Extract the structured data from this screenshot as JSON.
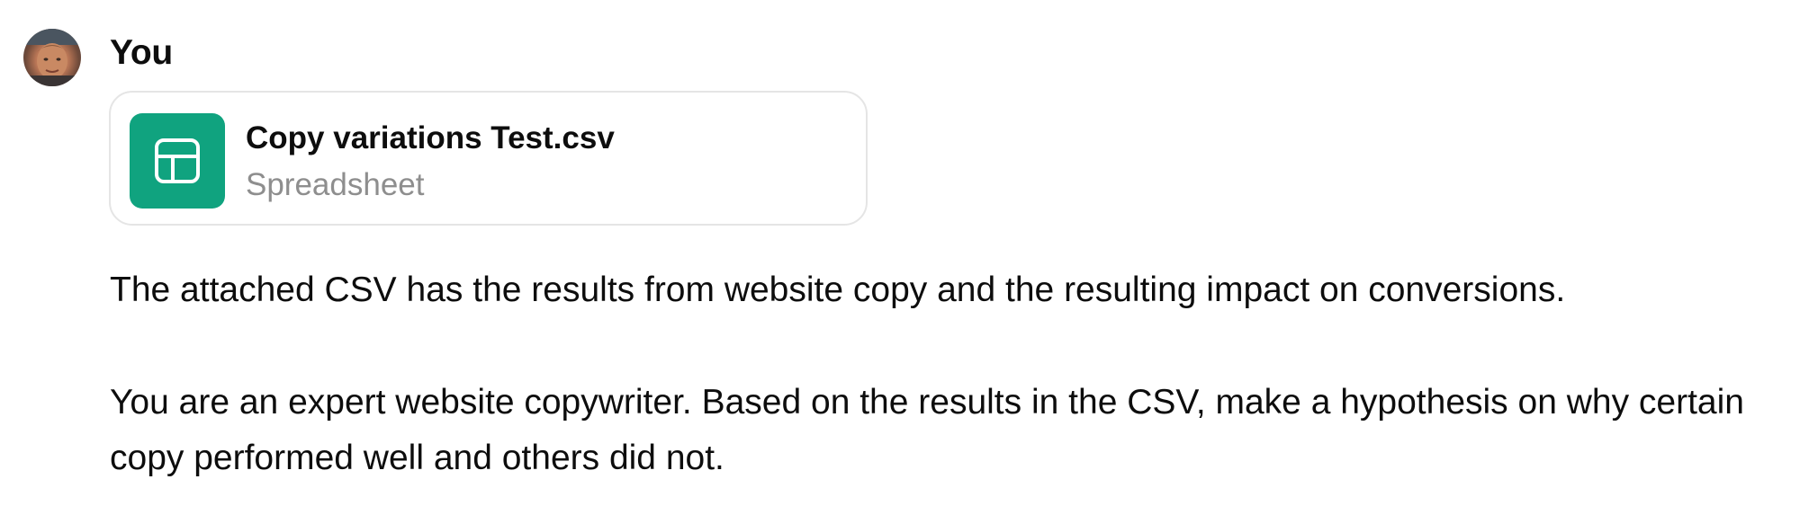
{
  "message": {
    "author": "You",
    "attachment": {
      "file_name": "Copy variations Test.csv",
      "file_type": "Spreadsheet",
      "icon": "spreadsheet-icon",
      "icon_color": "#10a37f"
    },
    "paragraphs": [
      "The attached CSV has the results from website copy and the resulting impact on conversions.",
      "You are an expert website copywriter. Based on the results in the CSV, make a hypothesis on why certain copy performed well and others did not."
    ]
  }
}
